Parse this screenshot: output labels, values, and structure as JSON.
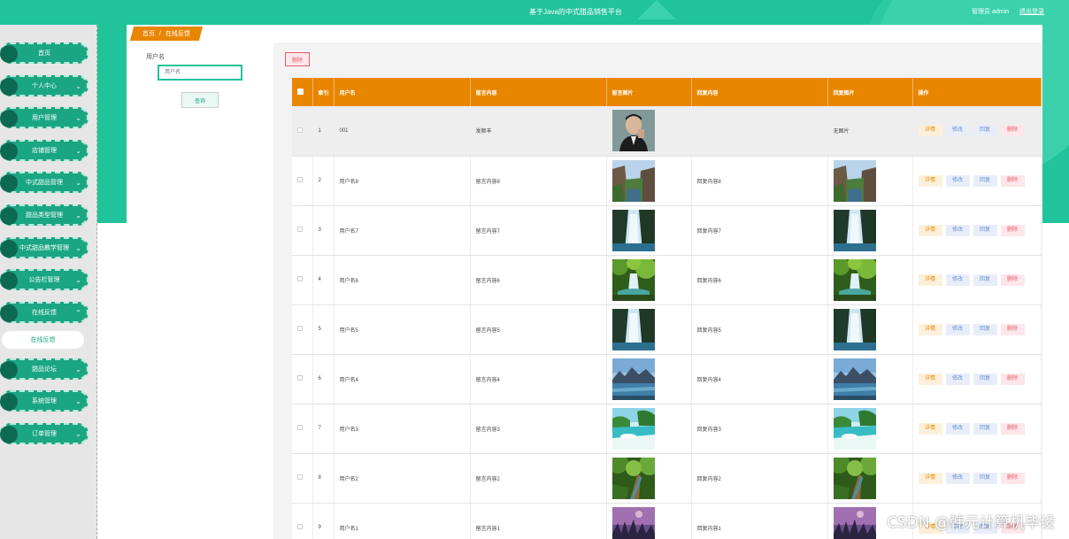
{
  "header": {
    "site_title": "基于Java的中式甜品销售平台",
    "user_info": "管理员 admin",
    "logout": "退出登录"
  },
  "sidebar": {
    "items": [
      {
        "label": "首页",
        "chevron": false
      },
      {
        "label": "个人中心",
        "chevron": true
      },
      {
        "label": "用户管理",
        "chevron": true
      },
      {
        "label": "店铺管理",
        "chevron": true
      },
      {
        "label": "中式甜品管理",
        "chevron": true
      },
      {
        "label": "甜品类型管理",
        "chevron": true
      },
      {
        "label": "中式甜品教学管理",
        "chevron": true
      },
      {
        "label": "公告栏管理",
        "chevron": true
      },
      {
        "label": "在线反馈",
        "chevron": true,
        "expanded": true
      },
      {
        "label": "甜品论坛",
        "chevron": true
      },
      {
        "label": "系统管理",
        "chevron": true
      },
      {
        "label": "订单管理",
        "chevron": true
      }
    ],
    "sub_item": "在线反馈"
  },
  "breadcrumb": {
    "home": "首页",
    "separator": "/",
    "current": "在线反馈"
  },
  "search": {
    "label": "用户名",
    "placeholder": "用户名",
    "button": "查询"
  },
  "toolbar": {
    "batch_delete": "删除"
  },
  "table": {
    "headers": [
      "",
      "索引",
      "用户名",
      "留言内容",
      "留言图片",
      "回复内容",
      "回复图片",
      "操作"
    ],
    "actions": {
      "detail": "详情",
      "edit": "修改",
      "reply": "回复",
      "delete": "删除"
    },
    "rows": [
      {
        "index": "1",
        "username": "001",
        "content": "发顺丰",
        "image": "portrait",
        "reply": "",
        "reply_image": "none",
        "reply_image_text": "无图片"
      },
      {
        "index": "2",
        "username": "用户名8",
        "content": "留言内容8",
        "image": "canyon",
        "reply": "回复内容8",
        "reply_image": "canyon"
      },
      {
        "index": "3",
        "username": "用户名7",
        "content": "留言内容7",
        "image": "waterfall",
        "reply": "回复内容7",
        "reply_image": "waterfall"
      },
      {
        "index": "4",
        "username": "用户名6",
        "content": "留言内容6",
        "image": "forest-falls",
        "reply": "回复内容6",
        "reply_image": "forest-falls"
      },
      {
        "index": "5",
        "username": "用户名5",
        "content": "留言内容5",
        "image": "waterfall",
        "reply": "回复内容5",
        "reply_image": "waterfall"
      },
      {
        "index": "6",
        "username": "用户名4",
        "content": "留言内容4",
        "image": "lake-mountains",
        "reply": "回复内容4",
        "reply_image": "lake-mountains"
      },
      {
        "index": "7",
        "username": "用户名3",
        "content": "留言内容3",
        "image": "beach",
        "reply": "回复内容3",
        "reply_image": "beach"
      },
      {
        "index": "8",
        "username": "用户名2",
        "content": "留言内容2",
        "image": "forest-path",
        "reply": "回复内容2",
        "reply_image": "forest-path"
      },
      {
        "index": "9",
        "username": "用户名1",
        "content": "留言内容1",
        "image": "purple-sky",
        "reply": "回复内容1",
        "reply_image": "purple-sky"
      }
    ]
  },
  "watermark": "CSDN @韩元计算机毕设",
  "colors": {
    "accent": "#20c39a",
    "table_header": "#e88600",
    "sidebar_item": "#1aa683",
    "danger": "#e65a6d"
  }
}
